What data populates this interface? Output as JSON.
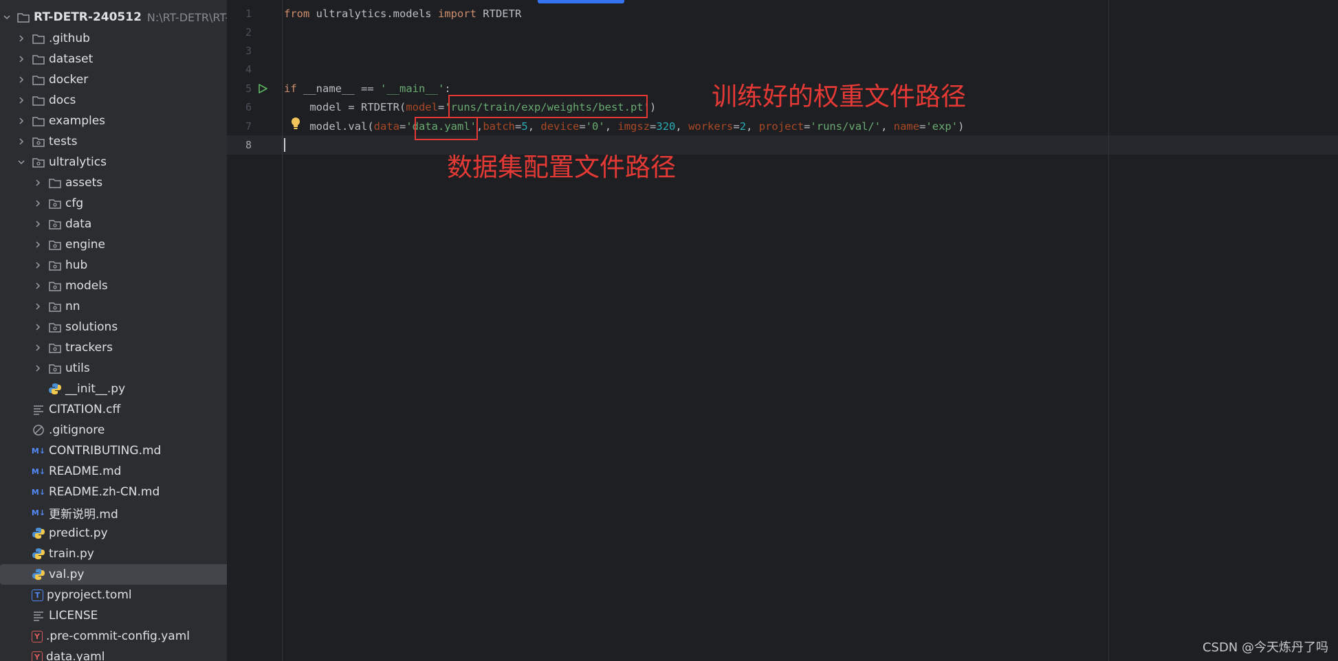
{
  "project": {
    "root_name": "RT-DETR-240512",
    "root_path": "N:\\RT-DETR\\RT-I",
    "items": [
      {
        "label": ".github",
        "type": "folder",
        "level": 1,
        "expanded": false
      },
      {
        "label": "dataset",
        "type": "folder",
        "level": 1,
        "expanded": false
      },
      {
        "label": "docker",
        "type": "folder",
        "level": 1,
        "expanded": false
      },
      {
        "label": "docs",
        "type": "folder",
        "level": 1,
        "expanded": false
      },
      {
        "label": "examples",
        "type": "folder",
        "level": 1,
        "expanded": false
      },
      {
        "label": "tests",
        "type": "package",
        "level": 1,
        "expanded": false
      },
      {
        "label": "ultralytics",
        "type": "package",
        "level": 1,
        "expanded": true
      },
      {
        "label": "assets",
        "type": "folder",
        "level": 2,
        "expanded": false
      },
      {
        "label": "cfg",
        "type": "package",
        "level": 2,
        "expanded": false
      },
      {
        "label": "data",
        "type": "package",
        "level": 2,
        "expanded": false
      },
      {
        "label": "engine",
        "type": "package",
        "level": 2,
        "expanded": false
      },
      {
        "label": "hub",
        "type": "package",
        "level": 2,
        "expanded": false
      },
      {
        "label": "models",
        "type": "package",
        "level": 2,
        "expanded": false
      },
      {
        "label": "nn",
        "type": "package",
        "level": 2,
        "expanded": false
      },
      {
        "label": "solutions",
        "type": "package",
        "level": 2,
        "expanded": false
      },
      {
        "label": "trackers",
        "type": "package",
        "level": 2,
        "expanded": false
      },
      {
        "label": "utils",
        "type": "package",
        "level": 2,
        "expanded": false
      },
      {
        "label": "__init__.py",
        "type": "python",
        "level": 2
      },
      {
        "label": "CITATION.cff",
        "type": "text",
        "level": 1
      },
      {
        "label": ".gitignore",
        "type": "ignore",
        "level": 1
      },
      {
        "label": "CONTRIBUTING.md",
        "type": "markdown",
        "level": 1
      },
      {
        "label": "README.md",
        "type": "markdown",
        "level": 1
      },
      {
        "label": "README.zh-CN.md",
        "type": "markdown",
        "level": 1
      },
      {
        "label": "更新说明.md",
        "type": "markdown",
        "level": 1
      },
      {
        "label": "predict.py",
        "type": "python",
        "level": 1
      },
      {
        "label": "train.py",
        "type": "python",
        "level": 1
      },
      {
        "label": "val.py",
        "type": "python",
        "level": 1,
        "selected": true
      },
      {
        "label": "pyproject.toml",
        "type": "toml",
        "level": 1
      },
      {
        "label": "LICENSE",
        "type": "text",
        "level": 1
      },
      {
        "label": ".pre-commit-config.yaml",
        "type": "yaml",
        "level": 1
      },
      {
        "label": "data.yaml",
        "type": "yaml",
        "level": 1
      }
    ]
  },
  "editor": {
    "line_numbers": [
      "1",
      "2",
      "3",
      "4",
      "5",
      "6",
      "7",
      "8"
    ],
    "current_line": "8",
    "lines": {
      "l1": {
        "kw1": "from",
        "mod": " ultralytics.models ",
        "kw2": "import",
        "name": " RTDETR"
      },
      "l5": {
        "kw": "if",
        "sp1": " ",
        "dn": "__name__",
        "op": " == ",
        "str": "'__main__'",
        "colon": ":"
      },
      "l6": {
        "a": "    model = RTDETR(",
        "p": "model",
        "eq": "=",
        "s": "'runs/train/exp/weights/best.pt'",
        "close": ")"
      },
      "l7": {
        "a": "    model.val(",
        "p1": "data",
        "e1": "=",
        "s1": "'data.yaml'",
        "c1": ",",
        "p2": "batch",
        "e2": "=",
        "n2": "5",
        "c2": ", ",
        "p3": "device",
        "e3": "=",
        "s3": "'0'",
        "c3": ", ",
        "p4": "imgsz",
        "e4": "=",
        "n4": "320",
        "c4": ", ",
        "p5": "workers",
        "e5": "=",
        "n5": "2",
        "c5": ", ",
        "p6": "project",
        "e6": "=",
        "s6": "'runs/val/'",
        "c6": ", ",
        "p7": "name",
        "e7": "=",
        "s7": "'exp'",
        "close": ")"
      }
    }
  },
  "annotations": {
    "weights_note": "训练好的权重文件路径",
    "dataset_note": "数据集配置文件路径"
  },
  "watermark": "CSDN @今天炼丹了吗",
  "colors": {
    "annotation": "#e53935",
    "keyword": "#cf8e6d",
    "string": "#6aab73",
    "number": "#2aacb8",
    "param": "#aa4926",
    "accent": "#3574f0"
  }
}
